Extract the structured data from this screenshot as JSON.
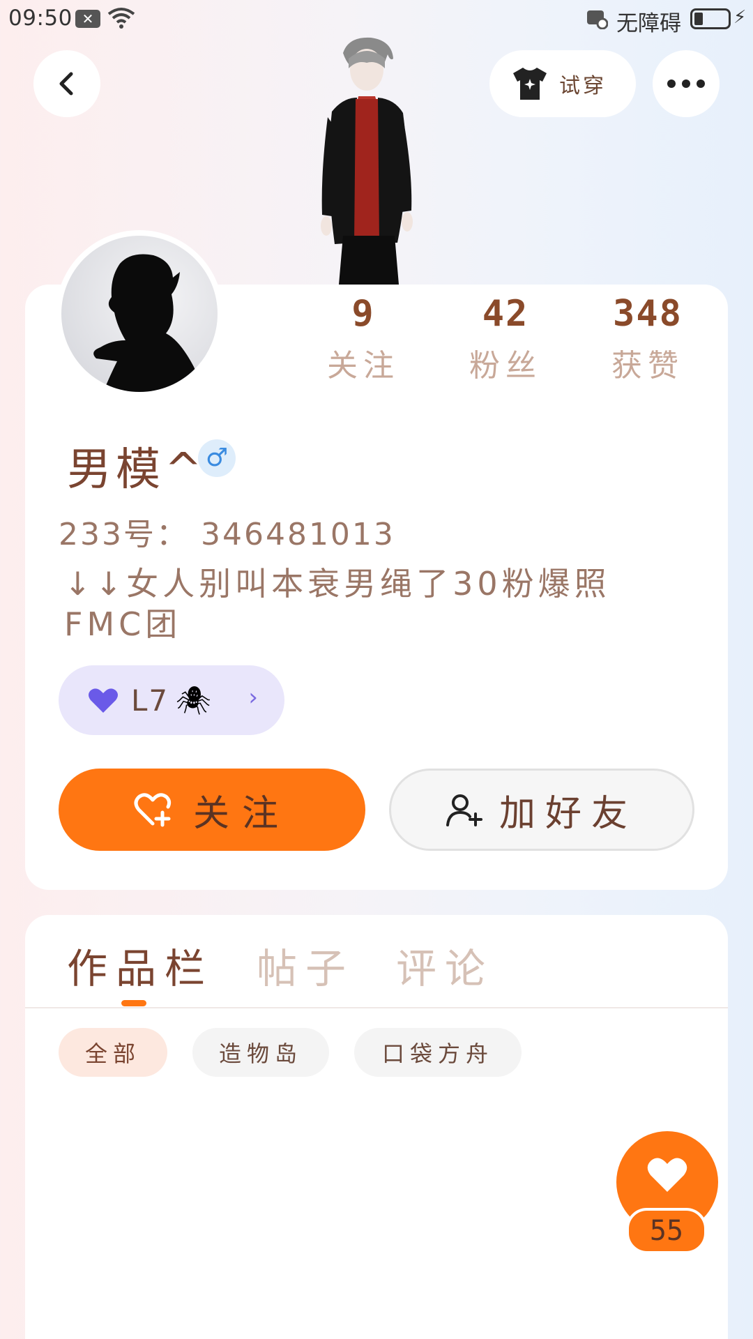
{
  "status_bar": {
    "time": "09:50",
    "accessibility_label": "无障碍"
  },
  "header": {
    "try_on_label": "试穿"
  },
  "stats": [
    {
      "value": "9",
      "label": "关注"
    },
    {
      "value": "42",
      "label": "粉丝"
    },
    {
      "value": "348",
      "label": "获赞"
    }
  ],
  "profile": {
    "nickname": "男模^",
    "gender_symbol": "♂",
    "uid": "233号： 346481013",
    "bio": "↓↓女人别叫本衰男绳了30粉爆照FMC团",
    "level": "L7",
    "level_emoji": "🕷"
  },
  "actions": {
    "follow_label": "关注",
    "add_friend_label": "加好友"
  },
  "tabs": [
    {
      "label": "作品栏",
      "active": true
    },
    {
      "label": "帖子",
      "active": false
    },
    {
      "label": "评论",
      "active": false
    }
  ],
  "chips": [
    {
      "label": "全部",
      "active": true
    },
    {
      "label": "造物岛",
      "active": false
    },
    {
      "label": "口袋方舟",
      "active": false
    }
  ],
  "like_fab": {
    "count": "55"
  },
  "colors": {
    "accent": "#ff7612",
    "text_brown": "#7a4430",
    "muted_label": "#c8a898",
    "level_pill_bg": "#e9e6fb"
  }
}
